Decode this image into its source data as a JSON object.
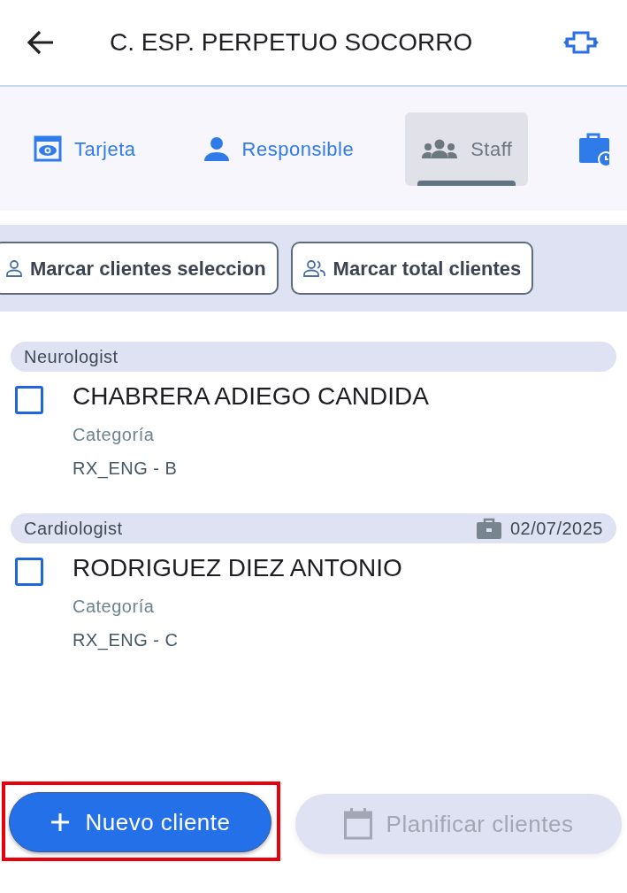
{
  "header": {
    "title": "C. ESP. PERPETUO SOCORRO"
  },
  "tabs": [
    {
      "kind": "card",
      "label": "Tarjeta",
      "selected": false
    },
    {
      "kind": "person",
      "label": "Responsible",
      "selected": false
    },
    {
      "kind": "group",
      "label": "Staff",
      "selected": true
    },
    {
      "kind": "schedule",
      "selected": false
    }
  ],
  "filters": [
    {
      "kind": "person",
      "label": "Marcar clientes seleccion"
    },
    {
      "kind": "group",
      "label": "Marcar total clientes"
    }
  ],
  "clients": [
    {
      "group": "Neurologist",
      "name": "CHABRERA ADIEGO CANDIDA",
      "field_label": "Categoría",
      "field_value": "RX_ENG - B",
      "checked": false
    },
    {
      "group": "Cardiologist",
      "date": "02/07/2025",
      "name": "RODRIGUEZ DIEZ ANTONIO",
      "field_label": "Categoría",
      "field_value": "RX_ENG - C",
      "checked": false
    }
  ],
  "actions": [
    {
      "kind": "add",
      "label": "Nuevo cliente",
      "disabled": false,
      "highlighted": true
    },
    {
      "kind": "calendar",
      "label": "Planificar clientes",
      "disabled": true,
      "highlighted": false
    }
  ]
}
